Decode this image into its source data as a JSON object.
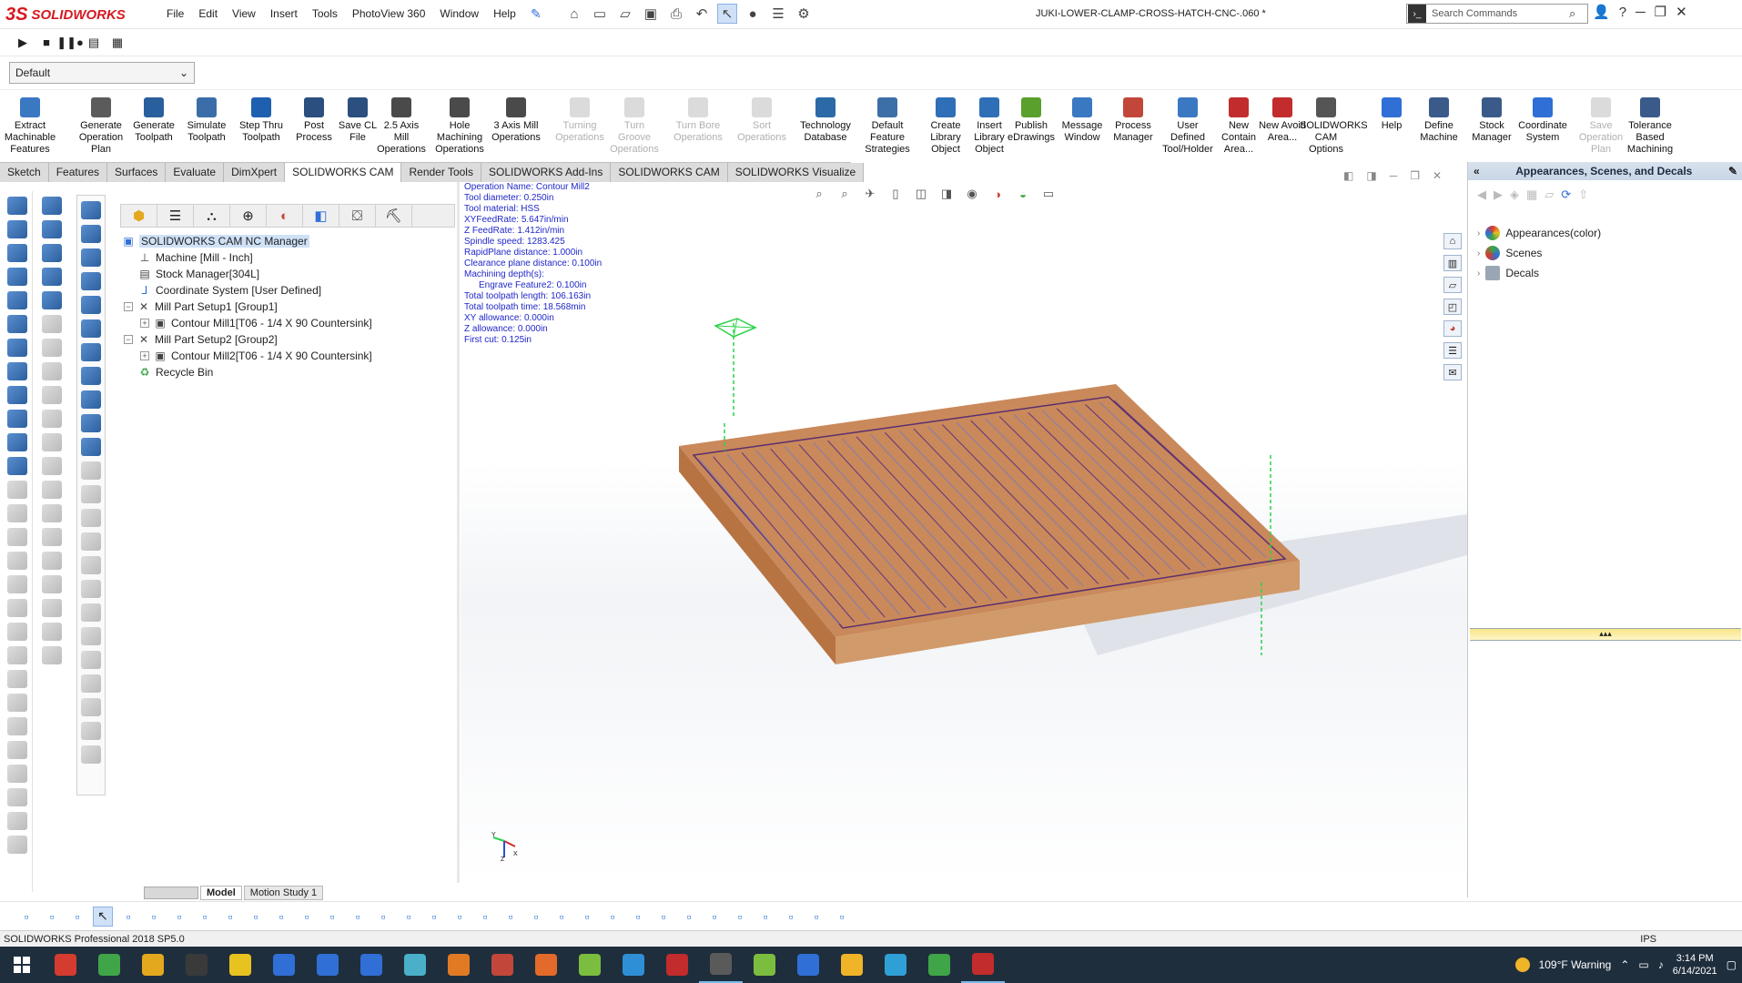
{
  "app": {
    "brand_prefix": "3S",
    "brand": "SOLIDWORKS",
    "doc_title": "JUKI-LOWER-CLAMP-CROSS-HATCH-CNC-.060 *"
  },
  "menu": [
    "File",
    "Edit",
    "View",
    "Insert",
    "Tools",
    "PhotoView 360",
    "Window",
    "Help"
  ],
  "search": {
    "placeholder": "Search Commands"
  },
  "config": {
    "value": "Default"
  },
  "ribbon": [
    {
      "label": "Extract Machinable Features",
      "enabled": true,
      "color": "#3a78c2"
    },
    {
      "label": "Generate Operation Plan",
      "enabled": true,
      "color": "#5b5b5b"
    },
    {
      "label": "Generate Toolpath",
      "enabled": true,
      "color": "#2a5f9e"
    },
    {
      "label": "Simulate Toolpath",
      "enabled": true,
      "color": "#3b6ea8"
    },
    {
      "label": "Step Thru Toolpath",
      "enabled": true,
      "color": "#1f5fb0"
    },
    {
      "label": "Post Process",
      "enabled": true,
      "color": "#2b4f7e"
    },
    {
      "label": "Save CL File",
      "enabled": true,
      "color": "#2b4f7e"
    },
    {
      "label": "2.5 Axis Mill Operations",
      "enabled": true,
      "color": "#4a4a4a"
    },
    {
      "label": "Hole Machining Operations",
      "enabled": true,
      "color": "#4a4a4a"
    },
    {
      "label": "3 Axis Mill Operations",
      "enabled": true,
      "color": "#4a4a4a"
    },
    {
      "label": "Turning Operations",
      "enabled": false,
      "color": "#999999"
    },
    {
      "label": "Turn Groove Operations",
      "enabled": false,
      "color": "#999999"
    },
    {
      "label": "Turn Bore Operations",
      "enabled": false,
      "color": "#999999"
    },
    {
      "label": "Sort Operations",
      "enabled": false,
      "color": "#999999"
    },
    {
      "label": "Technology Database",
      "enabled": true,
      "color": "#2b6aa6"
    },
    {
      "label": "Default Feature Strategies",
      "enabled": true,
      "color": "#3c6fa7"
    },
    {
      "label": "Create Library Object",
      "enabled": true,
      "color": "#2e6fb7"
    },
    {
      "label": "Insert Library Object",
      "enabled": true,
      "color": "#2e6fb7"
    },
    {
      "label": "Publish eDrawings",
      "enabled": true,
      "color": "#5aa02c"
    },
    {
      "label": "Message Window",
      "enabled": true,
      "color": "#3a78c2"
    },
    {
      "label": "Process Manager",
      "enabled": true,
      "color": "#c2473a"
    },
    {
      "label": "User Defined Tool/Holder",
      "enabled": true,
      "color": "#3a78c2"
    },
    {
      "label": "New Contain Area...",
      "enabled": true,
      "color": "#c22c2c"
    },
    {
      "label": "New Avoid Area...",
      "enabled": true,
      "color": "#c22c2c"
    },
    {
      "label": "SOLIDWORKS CAM Options",
      "enabled": true,
      "color": "#555555"
    },
    {
      "label": "Help",
      "enabled": true,
      "color": "#2f6fd6"
    },
    {
      "label": "Define Machine",
      "enabled": true,
      "color": "#3a5a8a"
    },
    {
      "label": "Stock Manager",
      "enabled": true,
      "color": "#3a5a8a"
    },
    {
      "label": "Coordinate System",
      "enabled": true,
      "color": "#2f6fd6"
    },
    {
      "label": "Save Operation Plan",
      "enabled": false,
      "color": "#999999"
    },
    {
      "label": "Tolerance Based Machining",
      "enabled": true,
      "color": "#3a5a8a"
    }
  ],
  "tabs": [
    {
      "label": "Sketch",
      "active": false
    },
    {
      "label": "Features",
      "active": false
    },
    {
      "label": "Surfaces",
      "active": false
    },
    {
      "label": "Evaluate",
      "active": false
    },
    {
      "label": "DimXpert",
      "active": false
    },
    {
      "label": "SOLIDWORKS CAM",
      "active": true
    },
    {
      "label": "Render Tools",
      "active": false
    },
    {
      "label": "SOLIDWORKS Add-Ins",
      "active": false
    },
    {
      "label": "SOLIDWORKS CAM",
      "active": false
    },
    {
      "label": "SOLIDWORKS Visualize",
      "active": false
    }
  ],
  "tree": {
    "root": "SOLIDWORKS CAM NC Manager",
    "items": [
      {
        "label": "Machine [Mill - Inch]",
        "icon": "machine-icon"
      },
      {
        "label": "Stock Manager[304L]",
        "icon": "stock-icon"
      },
      {
        "label": "Coordinate System [User Defined]",
        "icon": "coordinate-icon"
      },
      {
        "label": "Mill Part Setup1 [Group1]",
        "icon": "setup-icon"
      },
      {
        "label": "Contour Mill1[T06 - 1/4 X 90 Countersink]",
        "icon": "contour-mill-icon"
      },
      {
        "label": "Mill Part Setup2 [Group2]",
        "icon": "setup-icon"
      },
      {
        "label": "Contour Mill2[T06 - 1/4 X 90 Countersink]",
        "icon": "contour-mill-icon"
      },
      {
        "label": "Recycle Bin",
        "icon": "recycle-bin-icon"
      }
    ]
  },
  "info_lines": [
    "Operation Name: Contour Mill2",
    "Tool diameter: 0.250in",
    "Tool material: HSS",
    "XYFeedRate: 5.647in/min",
    "Z FeedRate: 1.412in/min",
    "Spindle speed: 1283.425",
    "RapidPlane distance: 1.000in",
    "Clearance plane distance: 0.100in",
    "Machining depth(s):",
    "    Engrave Feature2: 0.100in",
    "Total toolpath length: 106.163in",
    "Total toolpath time: 18.568min",
    "XY allowance: 0.000in",
    "Z allowance: 0.000in",
    "First cut: 0.125in"
  ],
  "model_tabs": [
    {
      "label": "Model",
      "active": true
    },
    {
      "label": "Motion Study 1",
      "active": false
    }
  ],
  "taskpane": {
    "title": "Appearances, Scenes, and Decals",
    "items": [
      {
        "label": "Appearances(color)"
      },
      {
        "label": "Scenes"
      },
      {
        "label": "Decals"
      }
    ]
  },
  "status": {
    "left": "SOLIDWORKS Professional 2018 SP5.0",
    "units": "IPS"
  },
  "taskbar": {
    "weather": "109°F  Warning",
    "time": "3:14 PM",
    "date": "6/14/2021",
    "app_colors": [
      "#d63b2f",
      "#3fa548",
      "#e3a81e",
      "#3a3a3a",
      "#e8c21f",
      "#2f6fd6",
      "#2f6fd6",
      "#2f6fd6",
      "#4ab0c9",
      "#e07b24",
      "#c2473a",
      "#e36a2a",
      "#7bbd3e",
      "#2f8fd6",
      "#c22c2c",
      "#5a5a5a",
      "#7bbd3e",
      "#2f6fd6",
      "#f0b429",
      "#2fa0d6",
      "#3fa548",
      "#c22c2c"
    ]
  }
}
